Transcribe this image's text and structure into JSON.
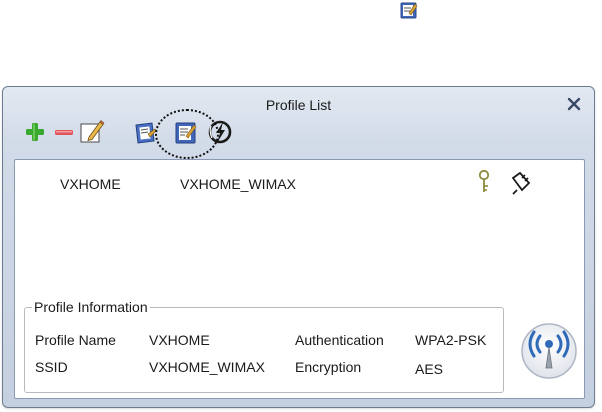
{
  "window": {
    "title": "Profile List"
  },
  "toolbar": {
    "buttons": [
      {
        "icon": "add-icon"
      },
      {
        "icon": "remove-icon"
      },
      {
        "icon": "edit-icon"
      },
      {
        "icon": "import-icon"
      },
      {
        "icon": "export-icon"
      },
      {
        "icon": "wps-icon"
      }
    ]
  },
  "profiles": [
    {
      "name": "VXHOME",
      "ssid": "VXHOME_WIMAX"
    }
  ],
  "profile_info": {
    "legend": "Profile Information",
    "profile_name_label": "Profile Name",
    "profile_name_value": "VXHOME",
    "ssid_label": "SSID",
    "ssid_value": "VXHOME_WIMAX",
    "auth_label": "Authentication",
    "auth_value": "WPA2-PSK",
    "enc_label": "Encryption",
    "enc_value": "AES"
  },
  "colors": {
    "add": "#39a82e",
    "remove": "#e0555a",
    "panel_top": "#e3e9f2",
    "panel_bottom": "#c4cfdf",
    "icon_blue": "#3f66b8"
  }
}
